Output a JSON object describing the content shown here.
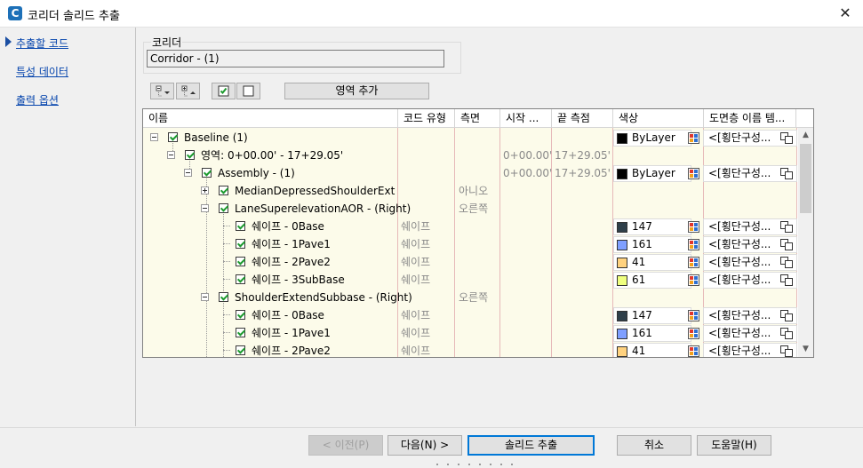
{
  "window": {
    "title": "코리더 솔리드 추출",
    "close_glyph": "✕",
    "app_icon": "C"
  },
  "nav": {
    "items": [
      "추출할 코드",
      "특성 데이터",
      "출력 옵션"
    ]
  },
  "corridor": {
    "label": "코리더",
    "value": "Corridor - (1)"
  },
  "toolbar": {
    "add_region": "영역 추가"
  },
  "grid": {
    "headers": [
      "이름",
      "코드 유형",
      "측면",
      "시작 ...",
      "끝 측점",
      "색상",
      "도면층 이름 템..."
    ],
    "rows": [
      {
        "name": "Baseline (1)",
        "code_type": "",
        "side": "",
        "start": "",
        "end": "",
        "color": "ByLayer",
        "swatch": "#000000",
        "layer": "<[횡단구성..."
      },
      {
        "name": "영역: 0+00.00' - 17+29.05'",
        "code_type": "",
        "side": "",
        "start": "0+00.00'",
        "end": "17+29.05'",
        "color": "",
        "swatch": "",
        "layer": ""
      },
      {
        "name": "Assembly - (1)",
        "code_type": "",
        "side": "",
        "start": "0+00.00'",
        "end": "17+29.05'",
        "color": "ByLayer",
        "swatch": "#000000",
        "layer": "<[횡단구성..."
      },
      {
        "name": "MedianDepressedShoulderExt",
        "code_type": "",
        "side": "아니오",
        "start": "",
        "end": "",
        "color": "",
        "swatch": "",
        "layer": ""
      },
      {
        "name": "LaneSuperelevationAOR - (Right)",
        "code_type": "",
        "side": "오른쪽",
        "start": "",
        "end": "",
        "color": "",
        "swatch": "",
        "layer": ""
      },
      {
        "name": "쉐이프 - 0Base",
        "code_type": "쉐이프",
        "side": "",
        "start": "",
        "end": "",
        "color": "147",
        "swatch": "#2f3f4a",
        "layer": "<[횡단구성..."
      },
      {
        "name": "쉐이프 - 1Pave1",
        "code_type": "쉐이프",
        "side": "",
        "start": "",
        "end": "",
        "color": "161",
        "swatch": "#7f9fff",
        "layer": "<[횡단구성..."
      },
      {
        "name": "쉐이프 - 2Pave2",
        "code_type": "쉐이프",
        "side": "",
        "start": "",
        "end": "",
        "color": "41",
        "swatch": "#ffd27f",
        "layer": "<[횡단구성..."
      },
      {
        "name": "쉐이프 - 3SubBase",
        "code_type": "쉐이프",
        "side": "",
        "start": "",
        "end": "",
        "color": "61",
        "swatch": "#efff7f",
        "layer": "<[횡단구성..."
      },
      {
        "name": "ShoulderExtendSubbase - (Right)",
        "code_type": "",
        "side": "오른쪽",
        "start": "",
        "end": "",
        "color": "",
        "swatch": "",
        "layer": ""
      },
      {
        "name": "쉐이프 - 0Base",
        "code_type": "쉐이프",
        "side": "",
        "start": "",
        "end": "",
        "color": "147",
        "swatch": "#2f3f4a",
        "layer": "<[횡단구성..."
      },
      {
        "name": "쉐이프 - 1Pave1",
        "code_type": "쉐이프",
        "side": "",
        "start": "",
        "end": "",
        "color": "161",
        "swatch": "#7f9fff",
        "layer": "<[횡단구성..."
      },
      {
        "name": "쉐이프 - 2Pave2",
        "code_type": "쉐이프",
        "side": "",
        "start": "",
        "end": "",
        "color": "41",
        "swatch": "#ffd27f",
        "layer": "<[횡단구성..."
      }
    ]
  },
  "buttons": {
    "prev": "< 이전(P)",
    "next": "다음(N) >",
    "extract": "솔리드 추출",
    "cancel": "취소",
    "help": "도움말(H)"
  }
}
